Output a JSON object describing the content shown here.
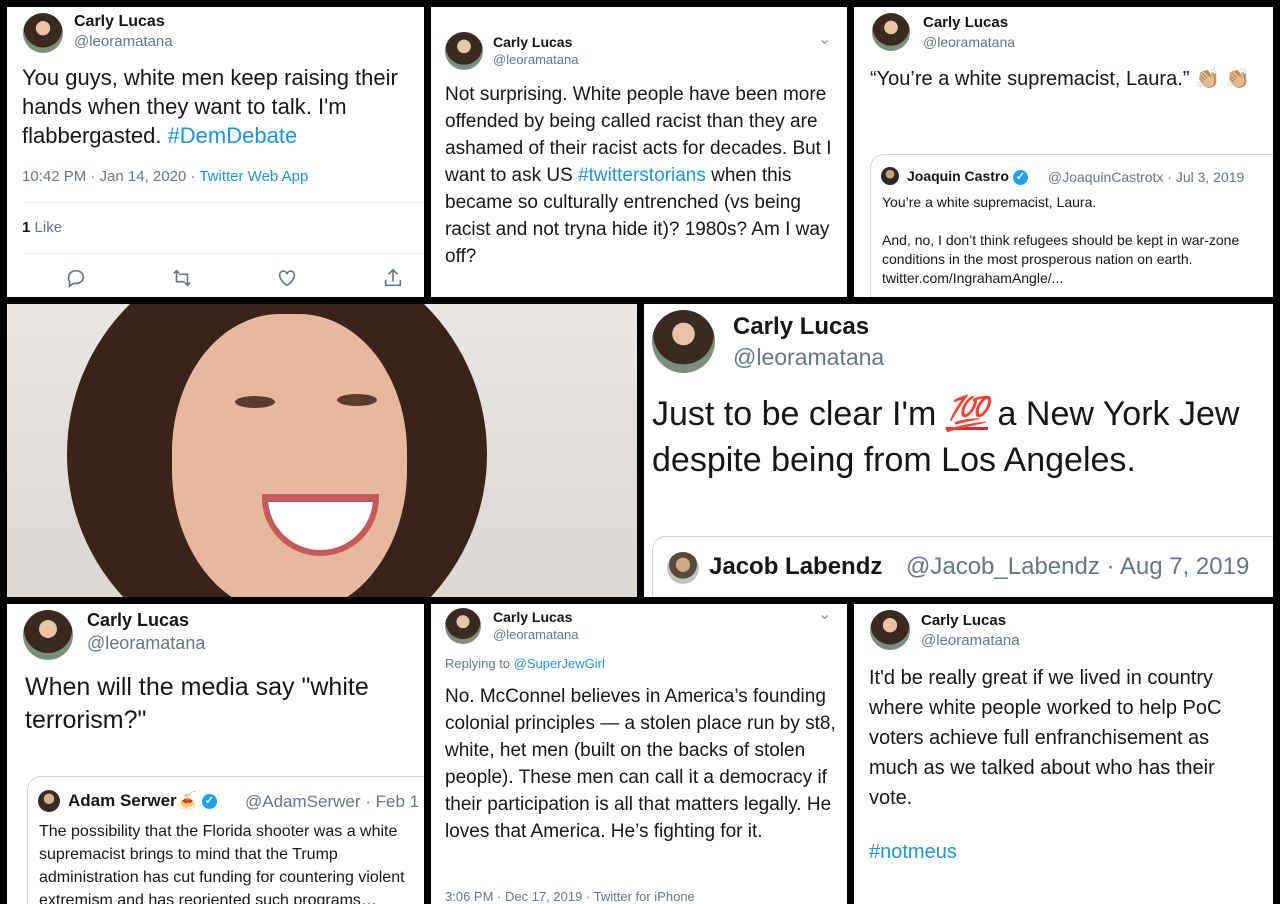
{
  "tweet1": {
    "name": "Carly Lucas",
    "handle": "@leoramatana",
    "text": "You guys, white men keep raising their hands when they want to talk. I'm flabbergasted.",
    "hashtag": "#DemDebate",
    "time": "10:42 PM · Jan 14, 2020 ·",
    "source": "Twitter Web App",
    "likes_count": "1",
    "likes_label": "Like",
    "actions": [
      "reply-icon",
      "retweet-icon",
      "like-icon",
      "share-icon"
    ]
  },
  "tweet2": {
    "name": "Carly Lucas",
    "handle": "@leoramatana",
    "text_before": "Not surprising. White people have been more offended by being called racist than they are ashamed of their racist acts for decades. But I want to ask US",
    "hashtag": "#twitterstorians",
    "text_after": "when this became so culturally entrenched (vs being racist and not tryna hide it)? 1980s? Am I way off?"
  },
  "tweet3": {
    "name": "Carly Lucas",
    "handle": "@leoramatana",
    "text": "“You’re a white supremacist, Laura.” 👏🏼 👏🏼",
    "quote": {
      "name": "Joaquin Castro",
      "handle": "@JoaquinCastrotx · Jul 3, 2019",
      "line1": "You’re a white supremacist, Laura.",
      "line2": "And, no, I don’t think refugees should be kept in war-zone conditions in the most prosperous nation on earth.",
      "url": "twitter.com/IngrahamAngle/..."
    }
  },
  "tweet4": {
    "name": "Carly Lucas",
    "handle": "@leoramatana",
    "text_before": "Just to be clear I'm",
    "emoji": "💯",
    "text_after": "a New York Jew despite being from Los Angeles.",
    "quote": {
      "name": "Jacob Labendz",
      "handle": "@Jacob_Labendz · Aug 7, 2019"
    }
  },
  "tweet5": {
    "name": "Carly Lucas",
    "handle": "@leoramatana",
    "text": "When will the media say \"white terrorism?\"",
    "quote": {
      "name": "Adam Serwer",
      "emoji": "🍝",
      "handle": "@AdamSerwer · Feb 1",
      "text": "The possibility that the Florida shooter was a white supremacist brings to mind that the Trump administration has cut funding for countering violent extremism and has reoriented such programs…"
    }
  },
  "tweet6": {
    "name": "Carly Lucas",
    "handle": "@leoramatana",
    "replying_label": "Replying to",
    "replying_to": "@SuperJewGirl",
    "text": "No. McConnel believes in America’s founding colonial principles — a stolen place run by st8, white, het men (built on the backs of stolen people). These men can call it a democracy if their participation is all that matters legally. He loves that America. He’s fighting for it.",
    "time": "3:06 PM · Dec 17, 2019 · Twitter for iPhone"
  },
  "tweet7": {
    "name": "Carly Lucas",
    "handle": "@leoramatana",
    "text": "It'd be really great if we lived in country where white people worked to help PoC voters achieve full enfranchisement as much as we talked about who has their vote.",
    "hashtag": "#notmeus"
  }
}
